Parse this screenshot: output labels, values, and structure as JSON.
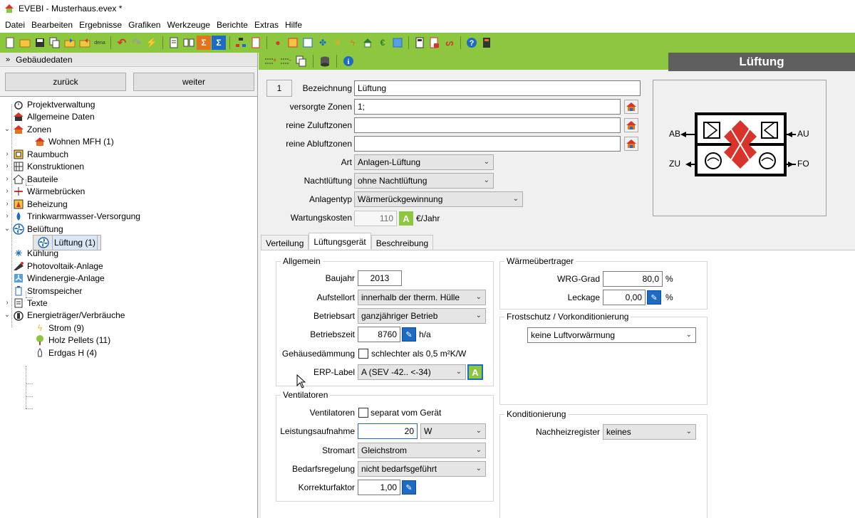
{
  "window": {
    "title": "EVEBI - Musterhaus.evex *"
  },
  "menu": [
    "Datei",
    "Bearbeiten",
    "Ergebnisse",
    "Grafiken",
    "Werkzeuge",
    "Berichte",
    "Extras",
    "Hilfe"
  ],
  "left_panel": {
    "header": "Gebäudedaten",
    "back_label": "zurück",
    "next_label": "weiter",
    "tree": [
      {
        "label": "Projektverwaltung",
        "icon": "stopwatch-icon"
      },
      {
        "label": "Allgemeine Daten",
        "icon": "house-icon"
      },
      {
        "label": "Zonen",
        "icon": "house-icon"
      },
      {
        "label": "Wohnen MFH (1)",
        "icon": "house-icon"
      },
      {
        "label": "Raumbuch",
        "icon": "room-icon"
      },
      {
        "label": "Konstruktionen",
        "icon": "wall-icon"
      },
      {
        "label": "Bauteile",
        "icon": "house-outline-icon"
      },
      {
        "label": "Wärmebrücken",
        "icon": "thermal-bridge-icon"
      },
      {
        "label": "Beheizung",
        "icon": "heating-icon"
      },
      {
        "label": "Trinkwarmwasser-Versorgung",
        "icon": "water-drop-icon"
      },
      {
        "label": "Belüftung",
        "icon": "fan-icon"
      },
      {
        "label": "Lüftung (1)",
        "icon": "fan-icon"
      },
      {
        "label": "Kühlung",
        "icon": "snowflake-icon"
      },
      {
        "label": "Photovoltaik-Anlage",
        "icon": "pv-icon"
      },
      {
        "label": "Windenergie-Anlage",
        "icon": "wind-icon"
      },
      {
        "label": "Stromspeicher",
        "icon": "battery-icon"
      },
      {
        "label": "Texte",
        "icon": "document-icon"
      },
      {
        "label": "Energieträger/Verbräuche",
        "icon": "plug-icon"
      },
      {
        "label": "Strom (9)",
        "icon": "lightning-icon"
      },
      {
        "label": "Holz Pellets (11)",
        "icon": "tree-icon"
      },
      {
        "label": "Erdgas H (4)",
        "icon": "flame-icon"
      }
    ]
  },
  "right_title": "Lüftung",
  "form": {
    "number": "1",
    "bezeichnung_label": "Bezeichnung",
    "bezeichnung": "Lüftung",
    "versorgte_label": "versorgte Zonen",
    "versorgte": "1;",
    "zuluft_label": "reine Zuluftzonen",
    "zuluft": "",
    "abluft_label": "reine Abluftzonen",
    "abluft": "",
    "art_label": "Art",
    "art": "Anlagen-Lüftung",
    "nacht_label": "Nachtlüftung",
    "nacht": "ohne Nachtlüftung",
    "anlagentyp_label": "Anlagentyp",
    "anlagentyp": "Wärmerückgewinnung",
    "wartung_label": "Wartungskosten",
    "wartung": "110",
    "wartung_unit": "€/Jahr",
    "a_label": "A"
  },
  "diagram": {
    "ab": "AB",
    "au": "AU",
    "zu": "ZU",
    "fo": "FO"
  },
  "tabs": [
    "Verteilung",
    "Lüftungsgerät",
    "Beschreibung"
  ],
  "allgemein": {
    "title": "Allgemein",
    "baujahr_label": "Baujahr",
    "baujahr": "2013",
    "aufstellort_label": "Aufstellort",
    "aufstellort": "innerhalb der therm. Hülle",
    "betriebsart_label": "Betriebsart",
    "betriebsart": "ganzjähriger Betrieb",
    "betriebszeit_label": "Betriebszeit",
    "betriebszeit": "8760",
    "betriebszeit_unit": "h/a",
    "daemmung_label": "Gehäusedämmung",
    "daemmung_check": "schlechter als 0,5 m²K/W",
    "erp_label": "ERP-Label",
    "erp": "A (SEV -42.. <-34)"
  },
  "ventilatoren": {
    "title": "Ventilatoren",
    "vent_label": "Ventilatoren",
    "vent_check": "separat vom Gerät",
    "leistung_label": "Leistungsaufnahme",
    "leistung": "20",
    "leistung_unit": "W",
    "stromart_label": "Stromart",
    "stromart": "Gleichstrom",
    "bedarf_label": "Bedarfsregelung",
    "bedarf": "nicht bedarfsgeführt",
    "korrektur_label": "Korrekturfaktor",
    "korrektur": "1,00"
  },
  "waermeuebertrager": {
    "title": "Wärmeübertrager",
    "wrg_label": "WRG-Grad",
    "wrg": "80,0",
    "leckage_label": "Leckage",
    "leckage": "0,00",
    "unit": "%"
  },
  "frostschutz": {
    "title": "Frostschutz / Vorkonditionierung",
    "value": "keine Luftvorwärmung"
  },
  "konditionierung": {
    "title": "Konditionierung",
    "nachheiz_label": "Nachheizregister",
    "nachheiz": "keines"
  },
  "colors": {
    "toolbar_green": "#8dc63f",
    "title_gray": "#5f5f5f",
    "heat_red": "#d9342b"
  }
}
